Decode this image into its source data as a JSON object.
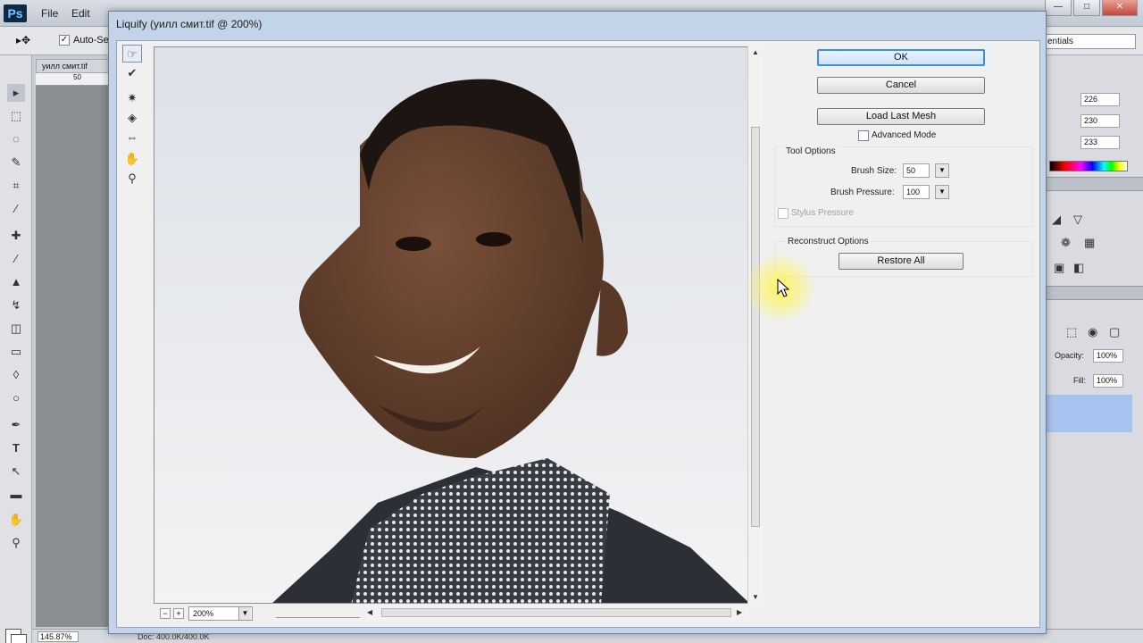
{
  "app": {
    "logo": "Ps",
    "menus": [
      "File",
      "Edit"
    ],
    "window_controls": [
      "—",
      "□",
      "✕"
    ]
  },
  "options_bar": {
    "tool_icon": "move-tool-icon",
    "auto_select_label": "Auto-Se",
    "auto_select_checked": true,
    "workspace": "entials"
  },
  "document": {
    "tab_title": "уилл смит.tif",
    "ruler_mark": "50",
    "status_zoom": "145.87%",
    "status_doc": "Doc: 400.0K/400.0K"
  },
  "right_panels": {
    "fields": [
      "226",
      "230",
      "233"
    ],
    "opacity_label": "Opacity:",
    "opacity_value": "100%",
    "fill_label": "Fill:",
    "fill_value": "100%"
  },
  "liquify": {
    "title": "Liquify (уилл смит.tif @ 200%)",
    "ok_label": "OK",
    "cancel_label": "Cancel",
    "load_mesh_label": "Load Last Mesh",
    "advanced_mode_label": "Advanced Mode",
    "advanced_mode_checked": false,
    "tool_options": {
      "heading": "Tool Options",
      "brush_size_label": "Brush Size:",
      "brush_size_value": "50",
      "brush_pressure_label": "Brush Pressure:",
      "brush_pressure_value": "100",
      "stylus_pressure_label": "Stylus Pressure",
      "stylus_pressure_checked": false
    },
    "reconstruct_options": {
      "heading": "Reconstruct Options",
      "restore_all_label": "Restore All"
    },
    "zoom_value": "200%",
    "tools": [
      "forward-warp-tool-icon",
      "reconstruct-tool-icon",
      "pucker-tool-icon",
      "bloat-tool-icon",
      "push-left-tool-icon",
      "hand-tool-icon",
      "zoom-tool-icon"
    ]
  }
}
